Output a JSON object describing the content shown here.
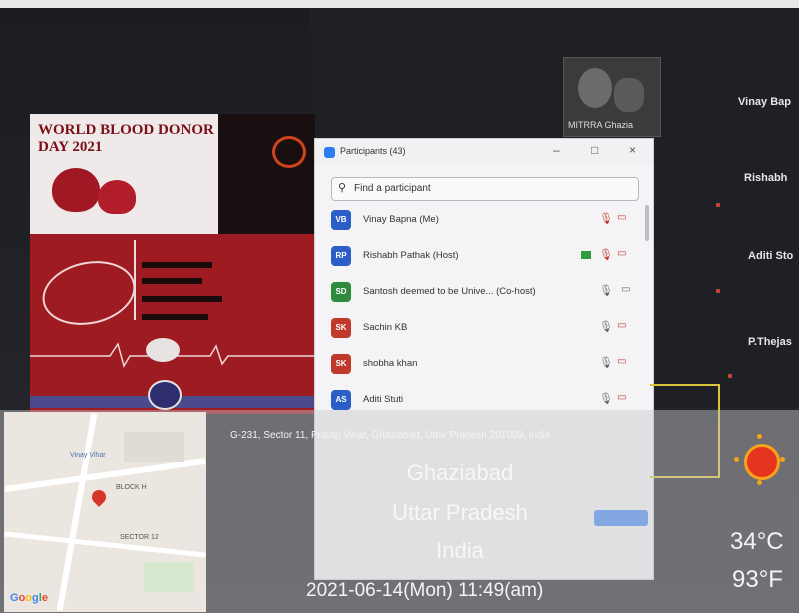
{
  "poster": {
    "title_line1": "WORLD BLOOD DONOR",
    "title_line2": "DAY 2021"
  },
  "meeting": {
    "cam_name": "MITRRA Ghazia",
    "grid_names": [
      "Vinay Bap",
      "Rishabh",
      "Aditi Sto",
      "P.Thejas"
    ]
  },
  "participants": {
    "title": "Participants (43)",
    "search_placeholder": "Find a participant",
    "rows": [
      {
        "initials": "VB",
        "color": "#2b5fc7",
        "name": "Vinay Bapna (Me)"
      },
      {
        "initials": "RP",
        "color": "#2b5fc7",
        "name": "Rishabh Pathak (Host)"
      },
      {
        "initials": "SD",
        "color": "#2e8b3e",
        "name": "Santosh deemed to be Unive... (Co-host)"
      },
      {
        "initials": "SK",
        "color": "#c0392b",
        "name": "Sachin KB"
      },
      {
        "initials": "SK",
        "color": "#c0392b",
        "name": "shobha khan"
      },
      {
        "initials": "AS",
        "color": "#2b5fc7",
        "name": "Aditi Stuti"
      }
    ]
  },
  "overlay": {
    "address": "G-231, Sector 11, Pratap Vihar, Ghaziabad, Uttar Pradesh 201009, India",
    "city": "Ghaziabad",
    "state": "Uttar Pradesh",
    "country": "India",
    "datetime": "2021-06-14(Mon)  11:49(am)",
    "temp_c": "34°C",
    "temp_f": "93°F",
    "google": "Google"
  },
  "map": {
    "labels": [
      "BLOCK H",
      "SECTOR 12",
      "Vinay Vihar"
    ]
  }
}
